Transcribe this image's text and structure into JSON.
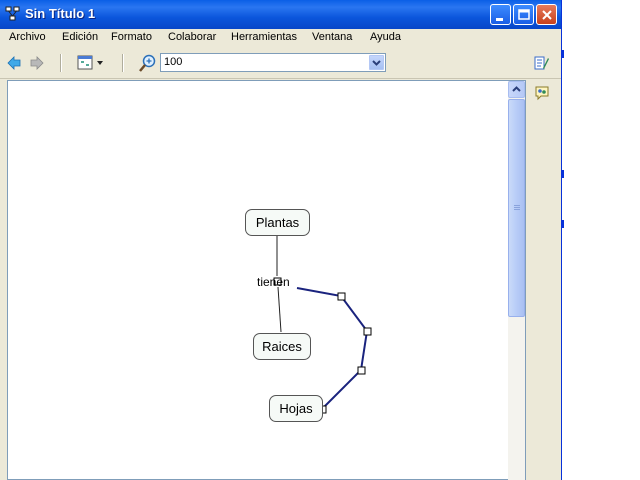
{
  "window": {
    "title": "Sin Título 1"
  },
  "menu": {
    "items": [
      "Archivo",
      "Edición",
      "Formato",
      "Colaborar",
      "Herramientas",
      "Ventana",
      "Ayuda"
    ]
  },
  "toolbar": {
    "zoom_value": "100"
  },
  "concept_map": {
    "nodes": [
      "Plantas",
      "Raices",
      "Hojas"
    ],
    "link_label": "tienen"
  },
  "colors": {
    "titlebar": "#0b56dc",
    "selected_link": "#1a237e",
    "node_fill": "#f6faf7"
  },
  "icons": [
    "app-icon",
    "minimize-icon",
    "maximize-icon",
    "close-icon",
    "back-arrow-icon",
    "forward-arrow-icon",
    "view-dropdown-icon",
    "zoom-icon",
    "chevron-down-icon",
    "styles-icon",
    "collaboration-icon"
  ]
}
